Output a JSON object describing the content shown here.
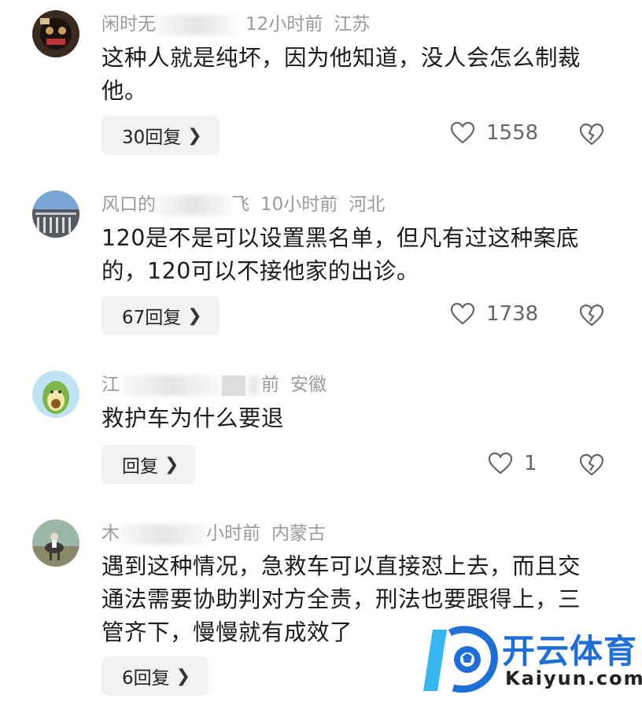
{
  "comments": [
    {
      "username_visible": "闲时无",
      "time": "12小时前",
      "location": "江苏",
      "text_line1": "这种人就是纯坏，因为他知道，没人会怎么制裁",
      "text_line2": "他。",
      "reply_label": "30回复",
      "likes": "1558"
    },
    {
      "username_visible_a": "风口的",
      "username_visible_b": "飞",
      "time": "10小时前",
      "location": "河北",
      "text_line1": "120是不是可以设置黑名单，但凡有过这种案底",
      "text_line2": "的，120可以不接他家的出诊。",
      "reply_label": "67回复",
      "likes": "1738"
    },
    {
      "username_visible": "江",
      "time_partial": "前",
      "location": "安徽",
      "text_line1": "救护车为什么要退",
      "reply_label": "回复",
      "likes": "1"
    },
    {
      "username_visible": "木",
      "time_partial": "小时前",
      "location": "内蒙古",
      "text_line1": "遇到这种情况，急救车可以直接怼上去，而且交",
      "text_line2": "通法需要协助判对方全责，刑法也要跟得上，三",
      "text_line3": "管齐下，慢慢就有成效了",
      "reply_label": "6回复"
    }
  ],
  "watermark": {
    "cn": "开云体育",
    "en": "Kaiyun.com"
  },
  "colors": {
    "meta_gray": "#9a9a9a",
    "reply_bg": "#f2f2f2",
    "watermark_blue": "#1f6fd8"
  },
  "icons": [
    "heart-icon",
    "broken-heart-icon",
    "chevron-right-icon"
  ]
}
